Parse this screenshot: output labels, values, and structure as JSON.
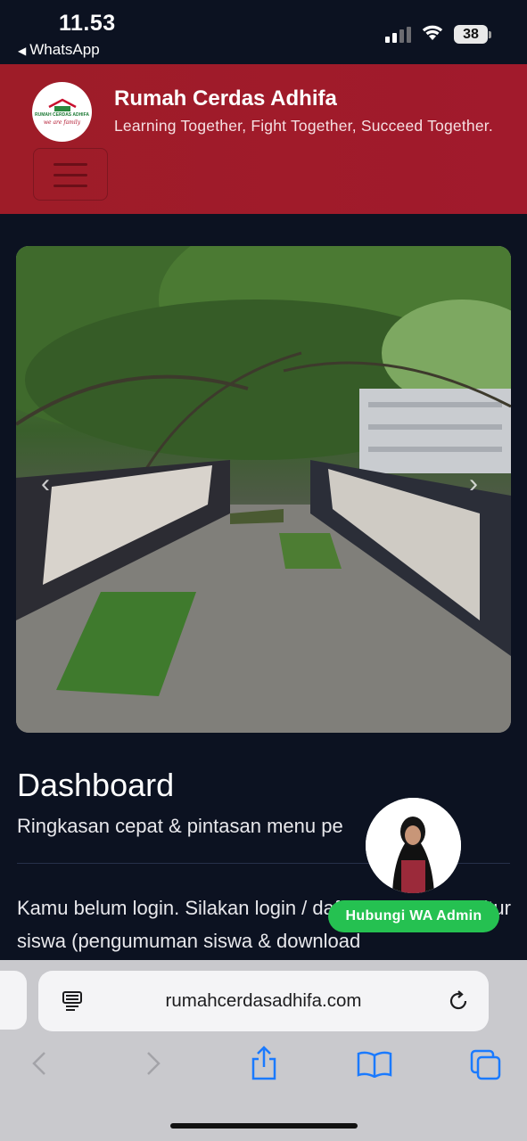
{
  "status_bar": {
    "time": "11.53",
    "back_app": "WhatsApp",
    "battery": "38"
  },
  "header": {
    "brand_title": "Rumah Cerdas Adhifa",
    "tagline": "Learning Together, Fight Together, Succeed Together.",
    "logo_text": "RUMAH CERDAS ADHIFA",
    "logo_tagline": "we are family"
  },
  "hero": {
    "icon_prev": "chevron-left-icon",
    "icon_next": "chevron-right-icon"
  },
  "dashboard": {
    "title": "Dashboard",
    "subtitle": "Ringkasan cepat & pintasan menu pe",
    "login_message": "Kamu belum login. Silakan login / daftar untuk akses fitur siswa (pengumuman siswa & download"
  },
  "wa_widget": {
    "button_label": "Hubungi WA Admin"
  },
  "browser": {
    "url": "rumahcerdasadhifa.com",
    "icons": [
      "reader-icon",
      "reload-icon",
      "back-icon",
      "forward-icon",
      "share-icon",
      "bookmarks-icon",
      "tabs-icon"
    ],
    "accent": "#1a7aff"
  }
}
